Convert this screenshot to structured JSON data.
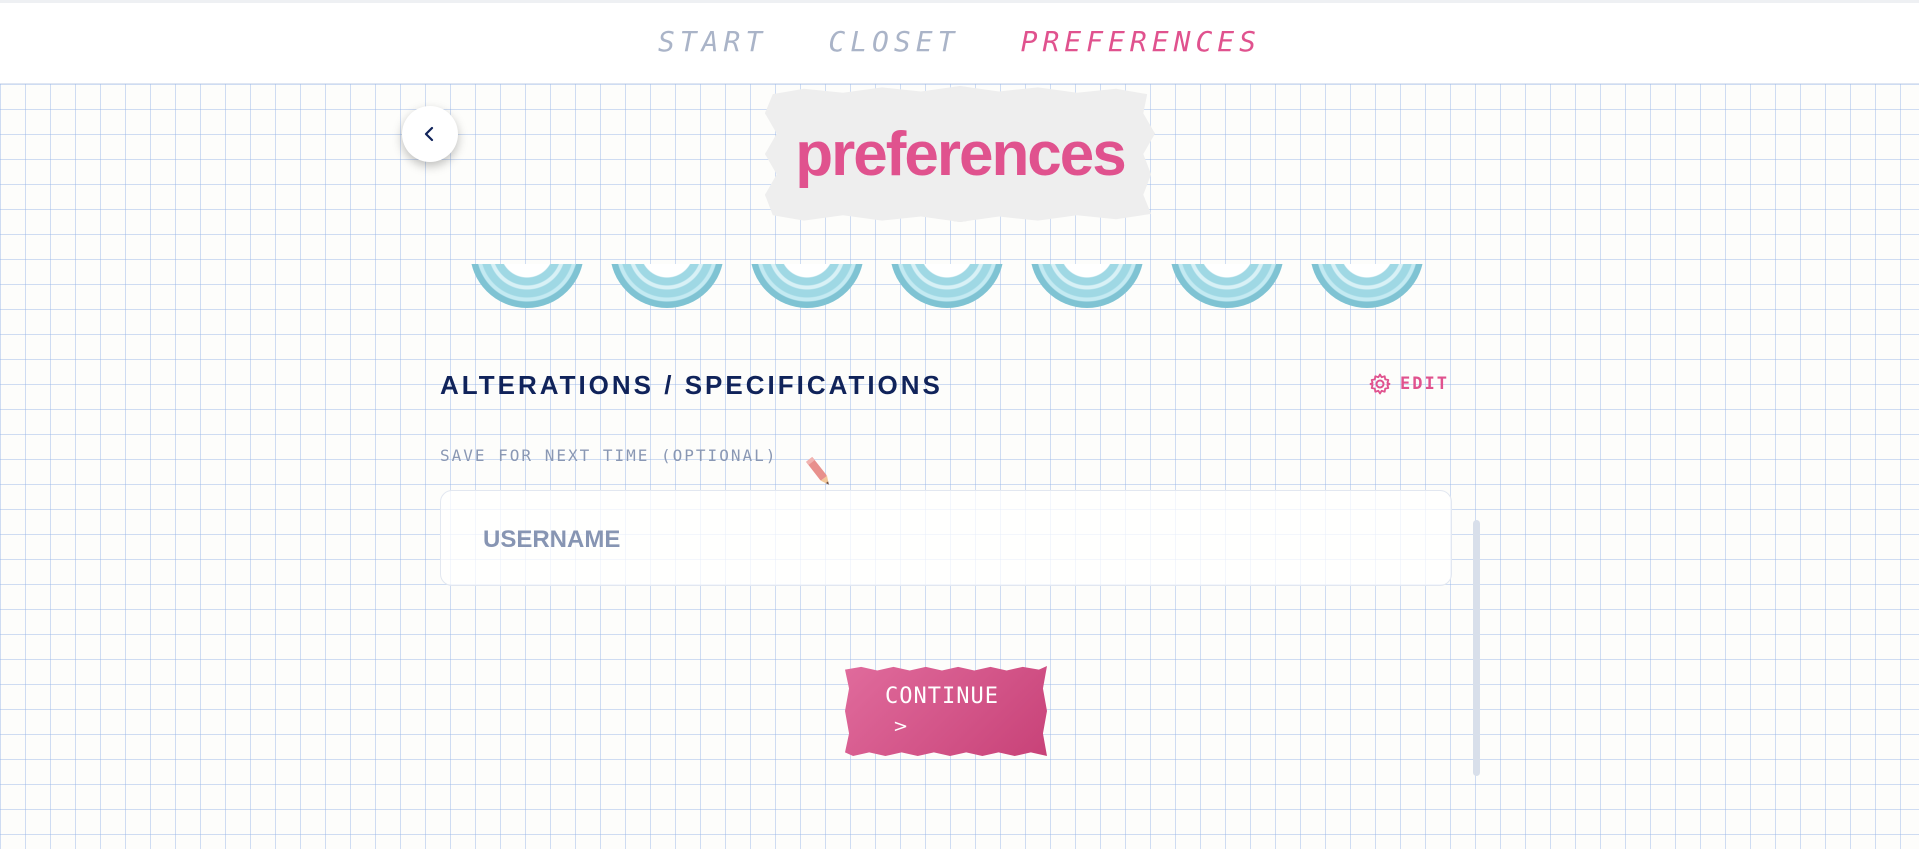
{
  "nav": {
    "items": [
      {
        "label": "START",
        "active": false
      },
      {
        "label": "CLOSET",
        "active": false
      },
      {
        "label": "PREFERENCES",
        "active": true
      }
    ]
  },
  "page": {
    "title": "preferences",
    "back_icon": "chevron-left-icon"
  },
  "section": {
    "title": "ALTERATIONS / SPECIFICATIONS",
    "edit_label": "EDIT",
    "edit_icon": "gear-icon"
  },
  "form": {
    "save_label": "SAVE FOR NEXT TIME (OPTIONAL)",
    "username_placeholder": "USERNAME",
    "username_value": ""
  },
  "continue": {
    "label": "CONTINUE",
    "arrow": ">"
  },
  "tape_count": 7,
  "colors": {
    "accent": "#e0528e",
    "navy": "#10235a",
    "muted": "#aab4c8",
    "tape": "#9fd8e4"
  }
}
